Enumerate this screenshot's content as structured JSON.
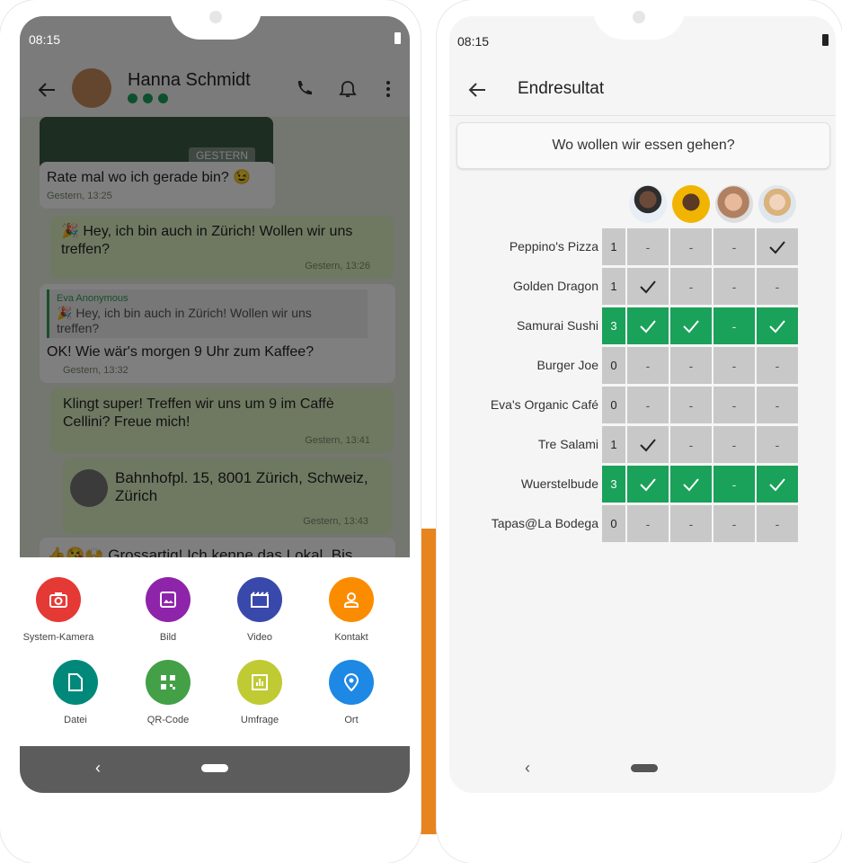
{
  "left_phone": {
    "status": {
      "time": "08:15"
    },
    "header": {
      "contact_name": "Hanna Schmidt",
      "icons": [
        "back-arrow-icon",
        "call-icon",
        "bell-icon",
        "more-icon"
      ]
    },
    "chat": {
      "image_date_badge": "GESTERN",
      "messages": [
        {
          "text": "Rate mal wo ich gerade bin? 😉",
          "time": "Gestern, 13:25",
          "direction": "in"
        },
        {
          "text": "🎉 Hey, ich bin auch in Zürich! Wollen wir uns treffen?",
          "time": "Gestern, 13:26",
          "direction": "out"
        },
        {
          "quote_author": "Eva Anonymous",
          "quote_text": "🎉 Hey, ich bin auch in Zürich! Wollen wir uns treffen?",
          "text": "OK! Wie wär's morgen 9 Uhr zum Kaffee?",
          "time": "Gestern, 13:32",
          "direction": "in"
        },
        {
          "text": "Klingt super! Treffen wir uns um 9 im Caffè Cellini? Freue mich!",
          "time": "Gestern, 13:41",
          "direction": "out"
        },
        {
          "text": "Bahnhofpl. 15, 8001 Zürich, Schweiz, Zürich",
          "time": "Gestern, 13:43",
          "direction": "out"
        },
        {
          "text": "👍😘🙌 Grossartig! Ich kenne das Lokal. Bis",
          "direction": "in"
        }
      ]
    },
    "attach_menu": [
      {
        "label": "System-Kamera",
        "color": "#e53935",
        "icon": "camera-icon"
      },
      {
        "label": "Bild",
        "color": "#8e24aa",
        "icon": "image-icon"
      },
      {
        "label": "Video",
        "color": "#3949ab",
        "icon": "video-icon"
      },
      {
        "label": "Kontakt",
        "color": "#fb8c00",
        "icon": "contact-icon"
      },
      {
        "label": "Datei",
        "color": "#00897b",
        "icon": "file-icon"
      },
      {
        "label": "QR-Code",
        "color": "#43a047",
        "icon": "qr-code-icon"
      },
      {
        "label": "Umfrage",
        "color": "#c0ca33",
        "icon": "poll-icon"
      },
      {
        "label": "Ort",
        "color": "#1e88e5",
        "icon": "location-icon"
      }
    ]
  },
  "right_phone": {
    "status": {
      "time": "08:15"
    },
    "header": {
      "title": "Endresultat"
    },
    "question": "Wo wollen wir essen gehen?",
    "results": [
      {
        "name": "Peppino's Pizza",
        "count": "1",
        "votes": [
          false,
          false,
          false,
          true
        ]
      },
      {
        "name": "Golden Dragon",
        "count": "1",
        "votes": [
          true,
          false,
          false,
          false
        ]
      },
      {
        "name": "Samurai Sushi",
        "count": "3",
        "votes": [
          true,
          true,
          false,
          true
        ],
        "winner": true
      },
      {
        "name": "Burger Joe",
        "count": "0",
        "votes": [
          false,
          false,
          false,
          false
        ]
      },
      {
        "name": "Eva's Organic Café",
        "count": "0",
        "votes": [
          false,
          false,
          false,
          false
        ]
      },
      {
        "name": "Tre Salami",
        "count": "1",
        "votes": [
          true,
          false,
          false,
          false
        ]
      },
      {
        "name": "Wuerstelbude",
        "count": "3",
        "votes": [
          true,
          true,
          false,
          true
        ],
        "winner": true
      },
      {
        "name": "Tapas@La Bodega",
        "count": "0",
        "votes": [
          false,
          false,
          false,
          false
        ]
      }
    ],
    "no_vote_mark": "-",
    "colors": {
      "winner": "#1aa15a",
      "cell": "#c8c8c8",
      "accent": "#e8841e"
    }
  }
}
